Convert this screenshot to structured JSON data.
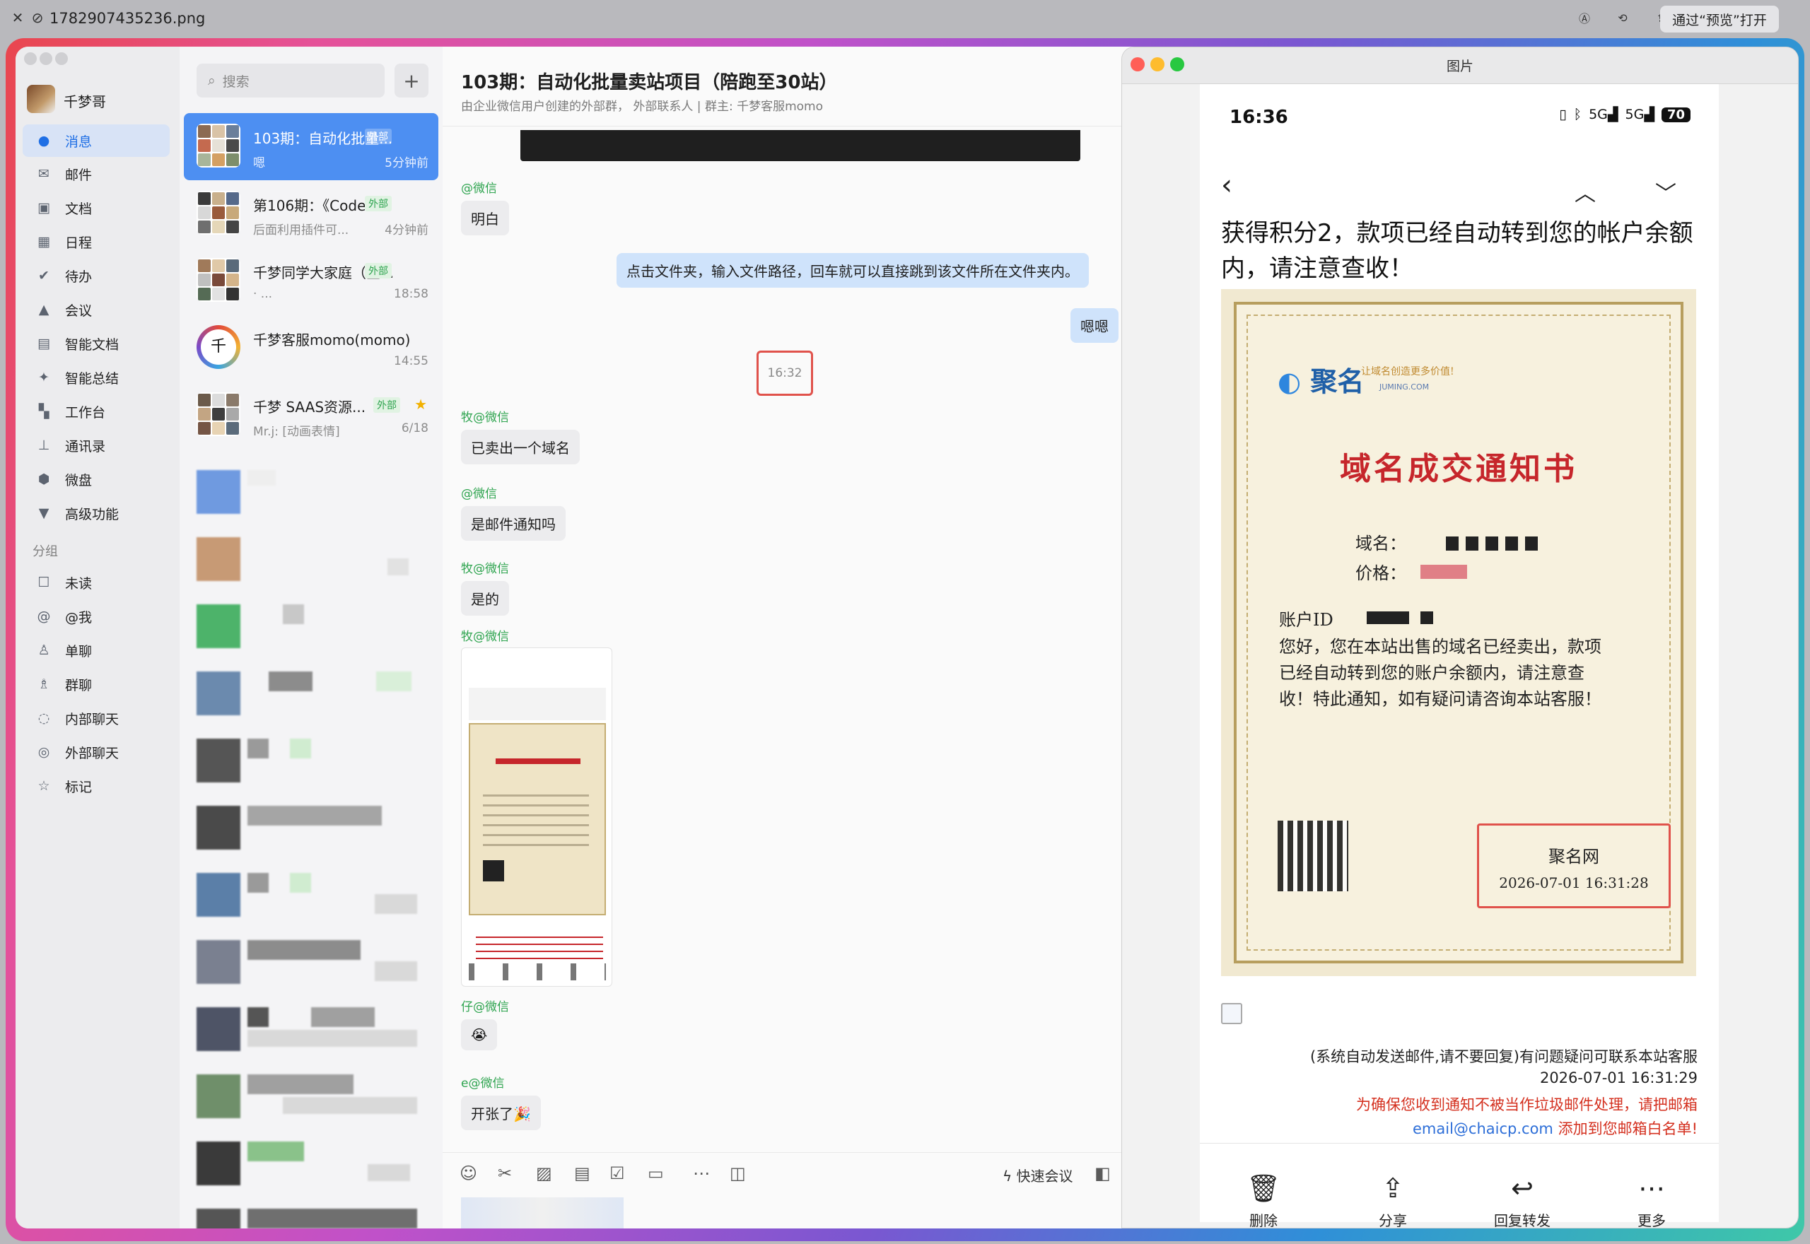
{
  "titlebar": {
    "filename": "1782907435236.png",
    "open_button": "通过“预览”打开"
  },
  "sidebar": {
    "user_name": "千梦哥",
    "items": [
      {
        "label": "消息",
        "icon": "message-icon",
        "active": true
      },
      {
        "label": "邮件",
        "icon": "mail-icon"
      },
      {
        "label": "文档",
        "icon": "doc-icon"
      },
      {
        "label": "日程",
        "icon": "calendar-icon"
      },
      {
        "label": "待办",
        "icon": "todo-icon"
      },
      {
        "label": "会议",
        "icon": "meeting-icon"
      },
      {
        "label": "智能文档",
        "icon": "smart-doc-icon"
      },
      {
        "label": "智能总结",
        "icon": "sparkle-icon"
      },
      {
        "label": "工作台",
        "icon": "grid-icon"
      },
      {
        "label": "通讯录",
        "icon": "contacts-icon"
      },
      {
        "label": "微盘",
        "icon": "drive-icon"
      },
      {
        "label": "高级功能",
        "icon": "advanced-icon"
      }
    ],
    "group_label": "分组",
    "groups": [
      {
        "label": "未读",
        "icon": "unread-icon"
      },
      {
        "label": "@我",
        "icon": "at-icon"
      },
      {
        "label": "单聊",
        "icon": "single-chat-icon"
      },
      {
        "label": "群聊",
        "icon": "group-chat-icon"
      },
      {
        "label": "内部聊天",
        "icon": "internal-chat-icon"
      },
      {
        "label": "外部聊天",
        "icon": "external-chat-icon"
      },
      {
        "label": "标记",
        "icon": "star-outline-icon"
      }
    ]
  },
  "conversation_list": {
    "search_placeholder": "搜索",
    "items": [
      {
        "title": "103期：自动化批量...",
        "tag": "外部",
        "preview": "嗯",
        "time": "5分钟前",
        "active": true
      },
      {
        "title": "第106期：《Codex...",
        "tag": "外部",
        "preview": "后面利用插件可...",
        "time": "4分钟前"
      },
      {
        "title": "千梦同学大家庭（全...",
        "tag": "外部",
        "preview": "·              ...",
        "time": "18:58"
      },
      {
        "title": "千梦客服momo(momo)",
        "tag": "",
        "preview": "",
        "time": "14:55"
      },
      {
        "title": "千梦 SAAS资源...",
        "tag": "外部",
        "preview": "Mr.j: [动画表情]",
        "time": "6/18",
        "starred": true
      }
    ]
  },
  "chat": {
    "title": "103期：自动化批量卖站项目（陪跑至30站）",
    "subtitle": "由企业微信用户创建的外部群，     外部联系人 | 群主: 千梦客服momo",
    "messages": [
      {
        "sender": "@微信",
        "text": "明白"
      },
      {
        "sender": "",
        "text": "点击文件夹，输入文件路径，回车就可以直接跳到该文件所在文件夹内。",
        "mine": true
      },
      {
        "sender": "",
        "text": "嗯嗯",
        "mine": true
      },
      {
        "time_divider": "16:32"
      },
      {
        "sender": "牧@微信",
        "text": "已卖出一个域名"
      },
      {
        "sender": "@微信",
        "text": "是邮件通知吗"
      },
      {
        "sender": "牧@微信",
        "text": "是的"
      },
      {
        "sender": "牧@微信",
        "text": "[图片]"
      },
      {
        "sender": "仔@微信",
        "text": "😭"
      },
      {
        "sender": "e@微信",
        "text": "开张了🎉"
      }
    ],
    "quick_meeting": "快速会议"
  },
  "viewer": {
    "window_title": "图片",
    "phone": {
      "time": "16:36",
      "signal_1": "5G",
      "signal_2": "5G",
      "battery": "70",
      "mail_headline": "获得积分2，款项已经自动转到您的帐户余额内，请注意查收！",
      "certificate": {
        "logo": "聚名",
        "logo_tagline": "让域名创造更多价值!",
        "logo_sub": "JUMING.COM",
        "heading": "域名成交通知书",
        "domain_label": "域名：",
        "price_label": "价格：",
        "account_label": "账户ID",
        "body": "您好，您在本站出售的域名已经卖出，款项已经自动转到您的账户余额内，请注意查收！特此通知，如有疑问请咨询本站客服！",
        "seal_name": "聚名网",
        "seal_time": "2026-07-01  16:31:28"
      },
      "footer": {
        "notice": "(系统自动发送邮件,请不要回复)有问题疑问可联系本站客服",
        "datetime": "2026-07-01 16:31:29",
        "warning": "为确保您收到通知不被当作垃圾邮件处理，请把邮箱",
        "email": "email@chaicp.com",
        "whitelist": "添加到您邮箱白名单!"
      },
      "actions": [
        {
          "label": "删除",
          "icon": "trash-icon"
        },
        {
          "label": "分享",
          "icon": "share-icon"
        },
        {
          "label": "回复转发",
          "icon": "reply-icon"
        },
        {
          "label": "更多",
          "icon": "more-icon"
        }
      ]
    }
  },
  "colors": {
    "accent_blue": "#4d8ff2",
    "highlight_red": "#e0524b",
    "cert_red": "#c6262b"
  }
}
